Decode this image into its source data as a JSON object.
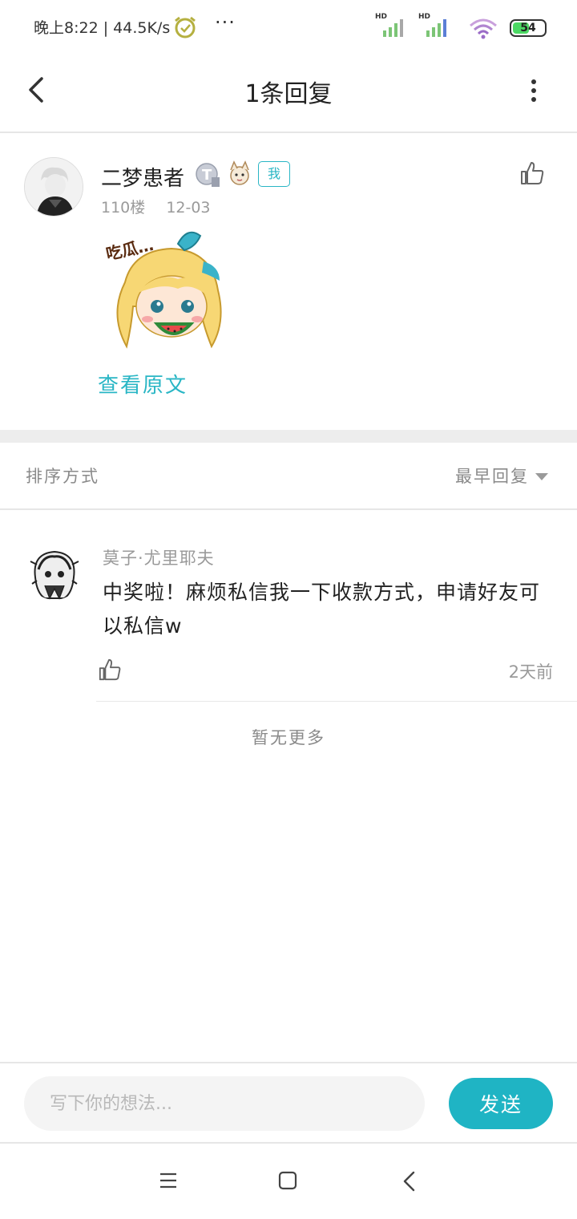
{
  "status_bar": {
    "time": "晚上8:22 | 44.5K/s",
    "more": "···",
    "signal_1_label": "HD",
    "signal_2_label": "HD",
    "battery": "54",
    "icons": [
      "alarm-icon",
      "signal-icon",
      "signal-icon",
      "wifi-icon",
      "battery-icon"
    ]
  },
  "header": {
    "title": "1条回复",
    "back_icon": "chevron-left-icon",
    "more_icon": "more-vertical-icon"
  },
  "post": {
    "username": "二梦患者",
    "me_tag": "我",
    "floor": "110楼",
    "date": "12-03",
    "view_original": "查看原文"
  },
  "sort": {
    "label": "排序方式",
    "selected": "最早回复"
  },
  "reply": {
    "username": "莫子·尤里耶夫",
    "text": "中奖啦！麻烦私信我一下收款方式，申请好友可以私信w",
    "time": "2天前"
  },
  "no_more": "暂无更多",
  "compose": {
    "placeholder": "写下你的想法...",
    "send": "发送"
  },
  "colors": {
    "accent": "#1fb4c4",
    "tag": "#29b6c5",
    "muted_text": "#9a9a9a",
    "divider": "#e6e6e6"
  }
}
